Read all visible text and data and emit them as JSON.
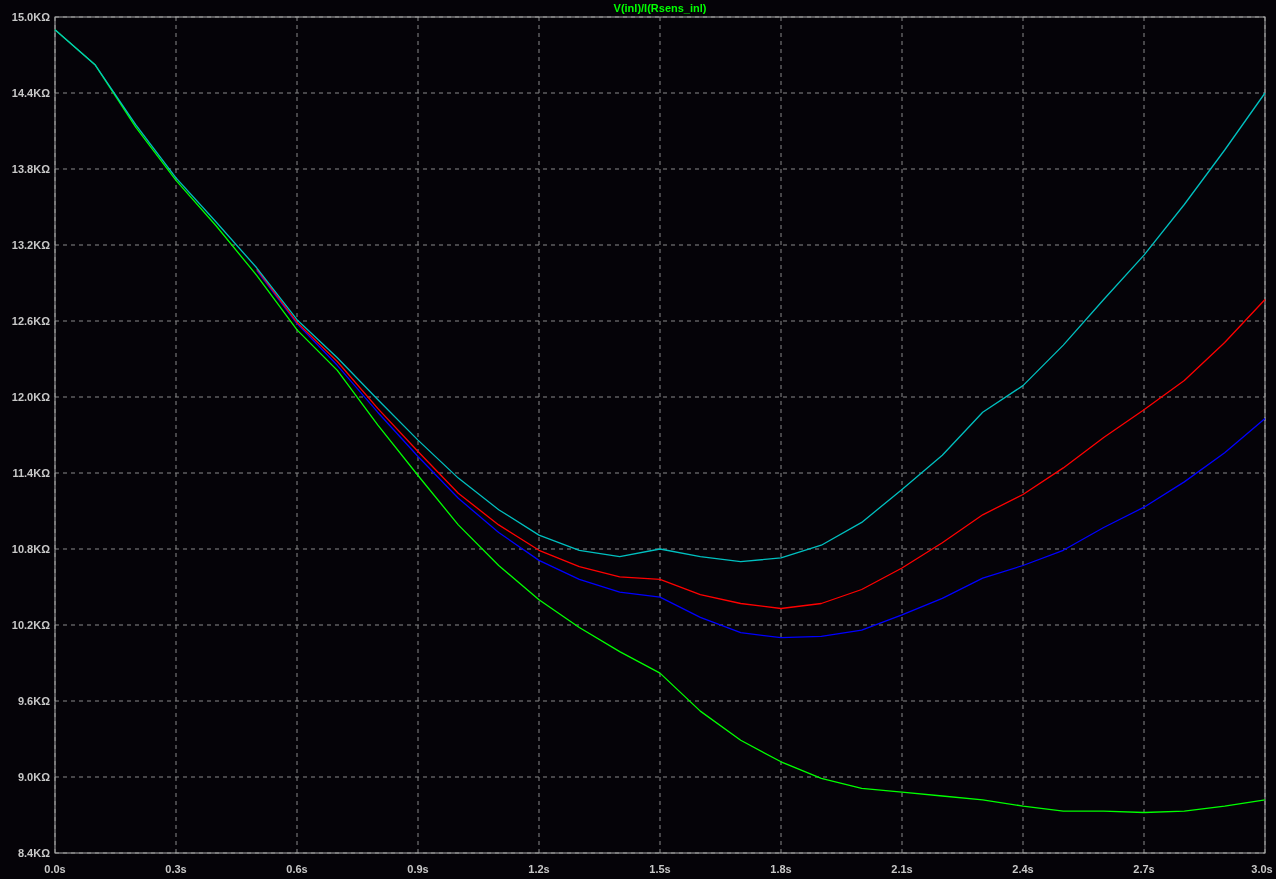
{
  "plot": {
    "chart_data": {
      "type": "line",
      "title": "V(inl)/I(Rsens_inl)",
      "grid": true,
      "x": [
        0,
        0.1,
        0.2,
        0.3,
        0.4,
        0.5,
        0.6,
        0.7,
        0.8,
        0.9,
        1.0,
        1.1,
        1.2,
        1.3,
        1.4,
        1.5,
        1.6,
        1.7,
        1.8,
        1.9,
        2.0,
        2.1,
        2.2,
        2.3,
        2.4,
        2.5,
        2.6,
        2.7,
        2.8,
        2.9,
        3.0
      ],
      "series": [
        {
          "color": "#00ff00",
          "values": [
            14.9,
            14.62,
            14.13,
            13.71,
            13.35,
            12.96,
            12.53,
            12.21,
            11.78,
            11.38,
            10.99,
            10.67,
            10.4,
            10.18,
            9.99,
            9.82,
            9.52,
            9.29,
            9.12,
            8.99,
            8.91,
            8.88,
            8.85,
            8.82,
            8.77,
            8.73,
            8.73,
            8.72,
            8.73,
            8.77,
            8.82
          ]
        },
        {
          "color": "#0000ff",
          "values": [
            null,
            null,
            null,
            null,
            null,
            13.0,
            12.58,
            12.25,
            11.88,
            11.53,
            11.2,
            10.93,
            10.71,
            10.56,
            10.46,
            10.42,
            10.26,
            10.14,
            10.1,
            10.11,
            10.16,
            10.28,
            10.41,
            10.57,
            10.67,
            10.79,
            10.97,
            11.13,
            11.33,
            11.56,
            11.83
          ]
        },
        {
          "color": "#ff0000",
          "values": [
            null,
            null,
            null,
            null,
            null,
            13.01,
            12.59,
            12.28,
            11.91,
            11.57,
            11.24,
            10.99,
            10.79,
            10.66,
            10.58,
            10.56,
            10.44,
            10.37,
            10.33,
            10.37,
            10.48,
            10.65,
            10.85,
            11.07,
            11.23,
            11.44,
            11.68,
            11.9,
            12.13,
            12.43,
            12.77
          ]
        },
        {
          "color": "#00c0c0",
          "values": [
            14.9,
            14.62,
            14.15,
            13.73,
            13.38,
            13.02,
            12.61,
            12.31,
            11.98,
            11.66,
            11.36,
            11.11,
            10.91,
            10.79,
            10.74,
            10.8,
            10.74,
            10.7,
            10.73,
            10.83,
            11.01,
            11.27,
            11.54,
            11.88,
            12.09,
            12.41,
            12.77,
            13.12,
            13.52,
            13.95,
            14.4
          ]
        }
      ],
      "xlim": [
        0,
        3.0
      ],
      "ylim": [
        8.4,
        15.0
      ],
      "xticks": [
        {
          "value": 0,
          "label": "0.0s"
        },
        {
          "value": 0.3,
          "label": "0.3s"
        },
        {
          "value": 0.6,
          "label": "0.6s"
        },
        {
          "value": 0.9,
          "label": "0.9s"
        },
        {
          "value": 1.2,
          "label": "1.2s"
        },
        {
          "value": 1.5,
          "label": "1.5s"
        },
        {
          "value": 1.8,
          "label": "1.8s"
        },
        {
          "value": 2.1,
          "label": "2.1s"
        },
        {
          "value": 2.4,
          "label": "2.4s"
        },
        {
          "value": 2.7,
          "label": "2.7s"
        },
        {
          "value": 3.0,
          "label": "3.0s"
        }
      ],
      "yticks": [
        {
          "value": 15.0,
          "label": "15.0KΩ"
        },
        {
          "value": 14.4,
          "label": "14.4KΩ"
        },
        {
          "value": 13.8,
          "label": "13.8KΩ"
        },
        {
          "value": 13.2,
          "label": "13.2KΩ"
        },
        {
          "value": 12.6,
          "label": "12.6KΩ"
        },
        {
          "value": 12.0,
          "label": "12.0KΩ"
        },
        {
          "value": 11.4,
          "label": "11.4KΩ"
        },
        {
          "value": 10.8,
          "label": "10.8KΩ"
        },
        {
          "value": 10.2,
          "label": "10.2KΩ"
        },
        {
          "value": 9.6,
          "label": "9.6KΩ"
        },
        {
          "value": 9.0,
          "label": "9.0KΩ"
        },
        {
          "value": 8.4,
          "label": "8.4KΩ"
        }
      ]
    }
  }
}
